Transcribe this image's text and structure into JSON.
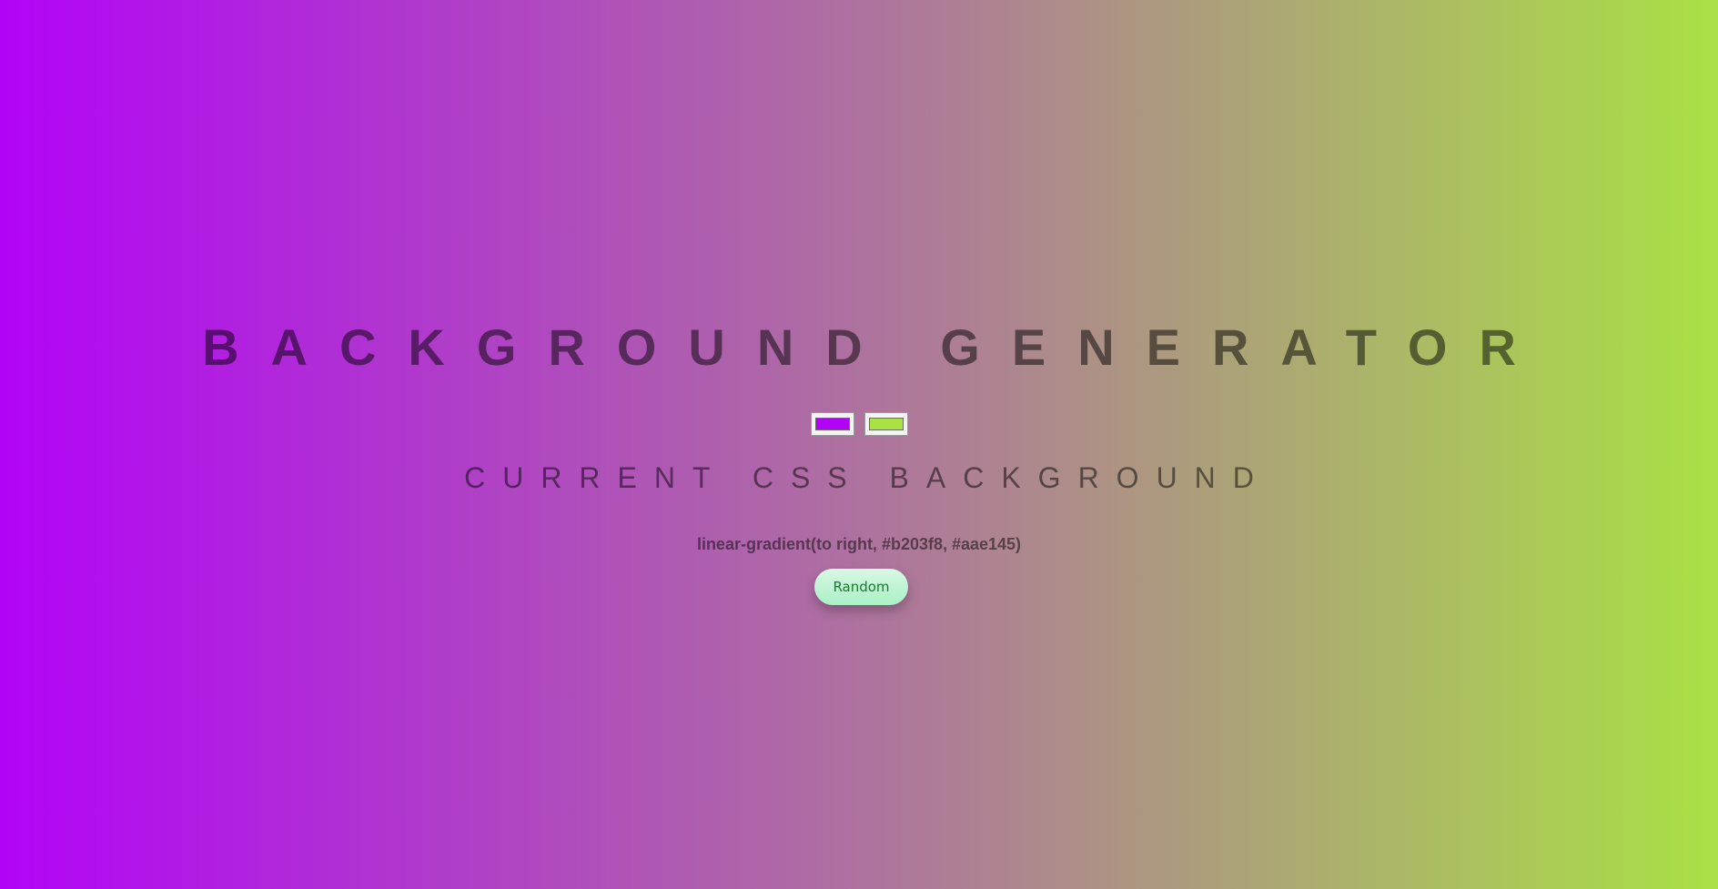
{
  "page": {
    "title": "BACKGROUND GENERATOR",
    "subtitle": "CURRENT CSS BACKGROUND",
    "css_value": "linear-gradient(to right, #b203f8, #aae145)"
  },
  "pickers": {
    "color1": "#b203f8",
    "color2": "#aae145"
  },
  "buttons": {
    "random_label": "Random"
  },
  "colors": {
    "gradient_start": "#b203f8",
    "gradient_end": "#aae145",
    "button_text": "#1c7a2c"
  }
}
